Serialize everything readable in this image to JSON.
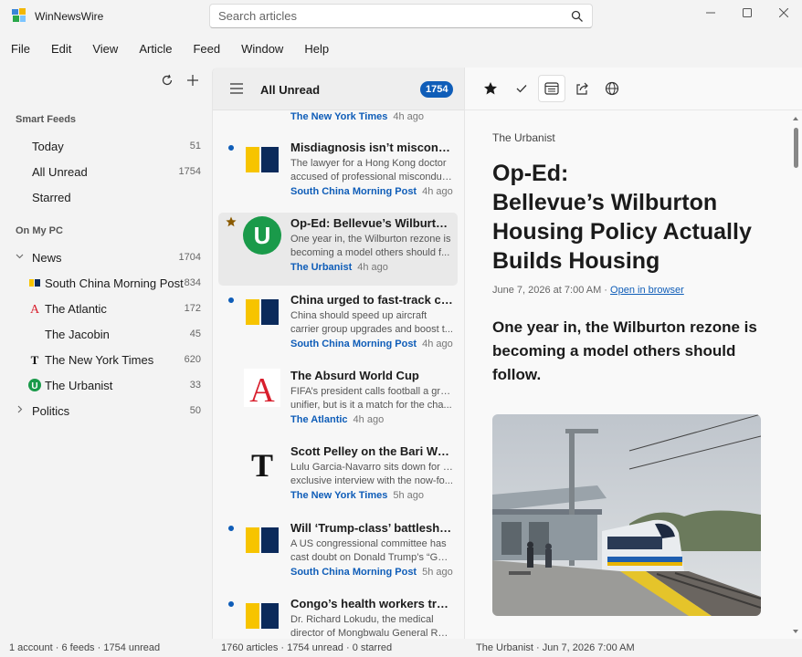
{
  "app": {
    "title": "WinNewsWire"
  },
  "search": {
    "placeholder": "Search articles"
  },
  "menu": [
    "File",
    "Edit",
    "View",
    "Article",
    "Feed",
    "Window",
    "Help"
  ],
  "sidebar": {
    "smart_label": "Smart Feeds",
    "smart": [
      {
        "label": "Today",
        "count": "51"
      },
      {
        "label": "All Unread",
        "count": "1754"
      },
      {
        "label": "Starred",
        "count": ""
      }
    ],
    "local_label": "On My PC",
    "folder_news": {
      "label": "News",
      "count": "1704"
    },
    "feeds": [
      {
        "label": "South China Morning Post",
        "count": "834",
        "icon": "scmp-icon"
      },
      {
        "label": "The Atlantic",
        "count": "172",
        "icon": "atlantic-icon"
      },
      {
        "label": "The Jacobin",
        "count": "45",
        "icon": ""
      },
      {
        "label": "The New York Times",
        "count": "620",
        "icon": "nyt-icon"
      },
      {
        "label": "The Urbanist",
        "count": "33",
        "icon": "urbanist-icon"
      }
    ],
    "folder_politics": {
      "label": "Politics",
      "count": "50"
    }
  },
  "list": {
    "title": "All Unread",
    "badge": "1754",
    "partial": {
      "source": "The New York Times",
      "time": "4h ago"
    },
    "items": [
      {
        "title": "Misdiagnosis isn’t misconduc...",
        "s1": "The lawyer for a Hong Kong doctor",
        "s2": "accused of professional misconduc...",
        "source": "South China Morning Post",
        "time": "4h ago"
      },
      {
        "title": "Op-Ed: Bellevue’s Wilburton...",
        "s1": "One year in, the Wilburton rezone is",
        "s2": "becoming a model others should f...",
        "source": "The Urbanist",
        "time": "4h ago"
      },
      {
        "title": "China urged to fast-track carr...",
        "s1": "China should speed up aircraft",
        "s2": "carrier group upgrades and boost t...",
        "source": "South China Morning Post",
        "time": "4h ago"
      },
      {
        "title": "The Absurd World Cup",
        "s1": "FIFA’s president calls football a great",
        "s2": "unifier, but is it a match for the cha...",
        "source": "The Atlantic",
        "time": "4h ago"
      },
      {
        "title": "Scott Pelley on the Bari Weiss...",
        "s1": "Lulu Garcia-Navarro sits down for an",
        "s2": "exclusive interview with the now-fo...",
        "source": "The New York Times",
        "time": "5h ago"
      },
      {
        "title": "Will ‘Trump-class’ battleship...",
        "s1": "A US congressional committee has",
        "s2": "cast doubt on Donald Trump’s “Gol...",
        "source": "South China Morning Post",
        "time": "5h ago"
      },
      {
        "title": "Congo’s health workers treat...",
        "s1": "Dr. Richard Lokudu, the medical",
        "s2": "director of Mongbwalu General Ref...",
        "source": "",
        "time": ""
      }
    ]
  },
  "reader": {
    "feed": "The Urbanist",
    "title_lines": [
      "Op-Ed:",
      "Bellevue’s Wilburton",
      "Housing Policy Actually",
      "Builds Housing"
    ],
    "date": "June 7, 2026 at 7:00 AM ·",
    "open_link": "Open in browser",
    "lede": "One year in, the Wilburton rezone is becoming a model others should follow."
  },
  "status": {
    "left": "1 account · 6 feeds · 1754 unread",
    "middle": "1760 articles · 1754 unread · 0 starred",
    "right": "The Urbanist · Jun 7, 2026 7:00 AM"
  },
  "colors": {
    "accent": "#0f5db8",
    "star": "#8a5a00",
    "urbanist": "#1a9a4a",
    "atlantic": "#d81e2c",
    "scmp_yellow": "#f7c400",
    "scmp_navy": "#0b2a5b"
  }
}
